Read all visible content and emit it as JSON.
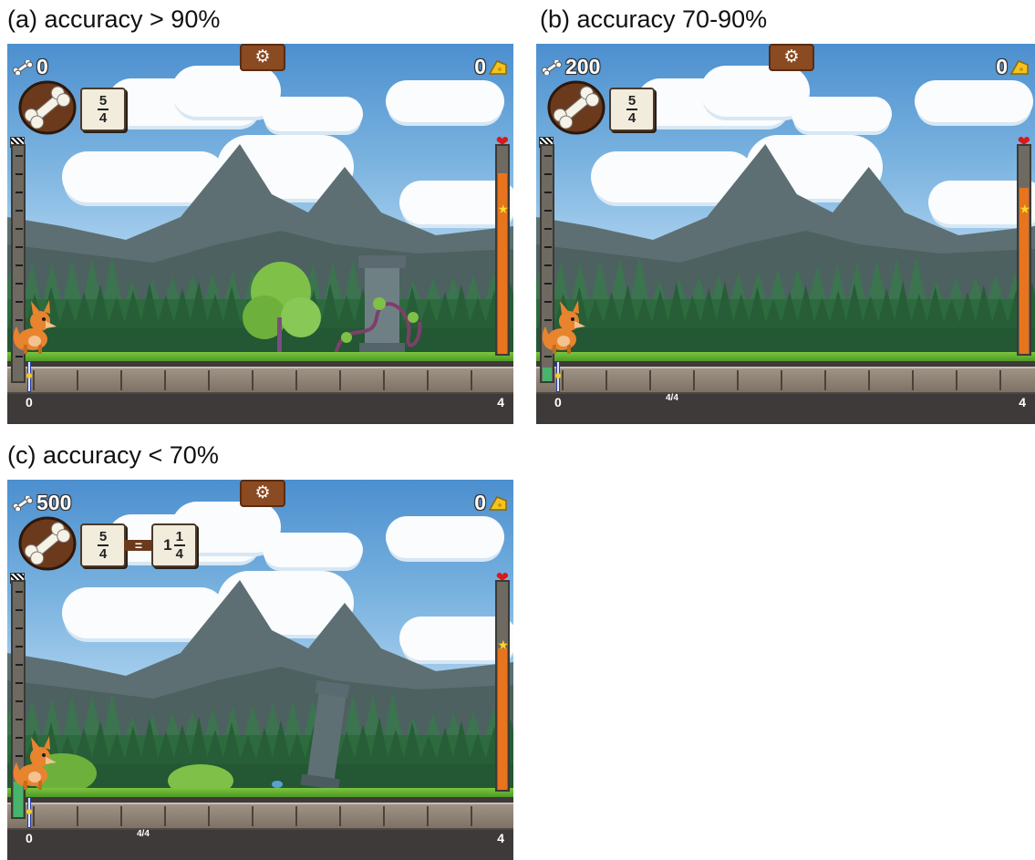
{
  "panels": [
    {
      "caption": "(a) accuracy > 90%",
      "bones": "0",
      "cheese": "0",
      "fraction": {
        "num": "5",
        "den": "4"
      },
      "mixed": null,
      "right_meter_level": 0.87,
      "left_meter_level": 0.0,
      "scene": "vine-pillar",
      "track": {
        "start": "0",
        "end": "4",
        "mid": ""
      },
      "icons": {
        "bone": "bone-icon",
        "cheese": "cheese-icon",
        "settings": "gear-icon",
        "health": "heart-icon",
        "goal": "star-icon",
        "finish": "checkered-flag-icon"
      }
    },
    {
      "caption": "(b) accuracy 70-90%",
      "bones": "200",
      "cheese": "0",
      "fraction": {
        "num": "5",
        "den": "4"
      },
      "mixed": null,
      "right_meter_level": 0.8,
      "left_meter_level": 0.06,
      "scene": "forest",
      "track": {
        "start": "0",
        "end": "4",
        "mid": "4/4"
      },
      "icons": {
        "bone": "bone-icon",
        "cheese": "cheese-icon",
        "settings": "gear-icon",
        "health": "heart-icon",
        "goal": "star-icon",
        "finish": "checkered-flag-icon"
      }
    },
    {
      "caption": "(c) accuracy < 70%",
      "bones": "500",
      "cheese": "0",
      "fraction": {
        "num": "5",
        "den": "4"
      },
      "mixed": {
        "equals": "=",
        "whole": "1",
        "num": "1",
        "den": "4"
      },
      "right_meter_level": 0.68,
      "left_meter_level": 0.15,
      "scene": "broken-pillar",
      "track": {
        "start": "0",
        "end": "4",
        "mid": "4/4"
      },
      "icons": {
        "bone": "bone-icon",
        "cheese": "cheese-icon",
        "settings": "gear-icon",
        "health": "heart-icon",
        "goal": "star-icon",
        "finish": "checkered-flag-icon"
      }
    }
  ],
  "colors": {
    "sky": "#79b2df",
    "mountain": "#5d6f72",
    "forest": "#2d6a3e",
    "grass": "#7cc43e",
    "fox": "#e8842e",
    "health": "#e8741d",
    "progress": "#46b46a"
  }
}
